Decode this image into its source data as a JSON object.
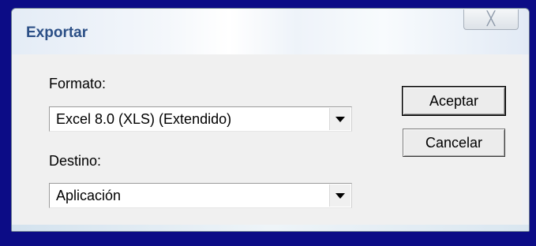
{
  "window": {
    "title": "Exportar",
    "close_glyph": "╳"
  },
  "form": {
    "format_label": "Formato:",
    "format_value": "Excel 8.0 (XLS) (Extendido)",
    "destination_label": "Destino:",
    "destination_value": "Aplicación"
  },
  "buttons": {
    "accept": "Aceptar",
    "cancel": "Cancelar"
  },
  "icons": {
    "dropdown": "chevron-down-icon",
    "close": "close-icon"
  }
}
